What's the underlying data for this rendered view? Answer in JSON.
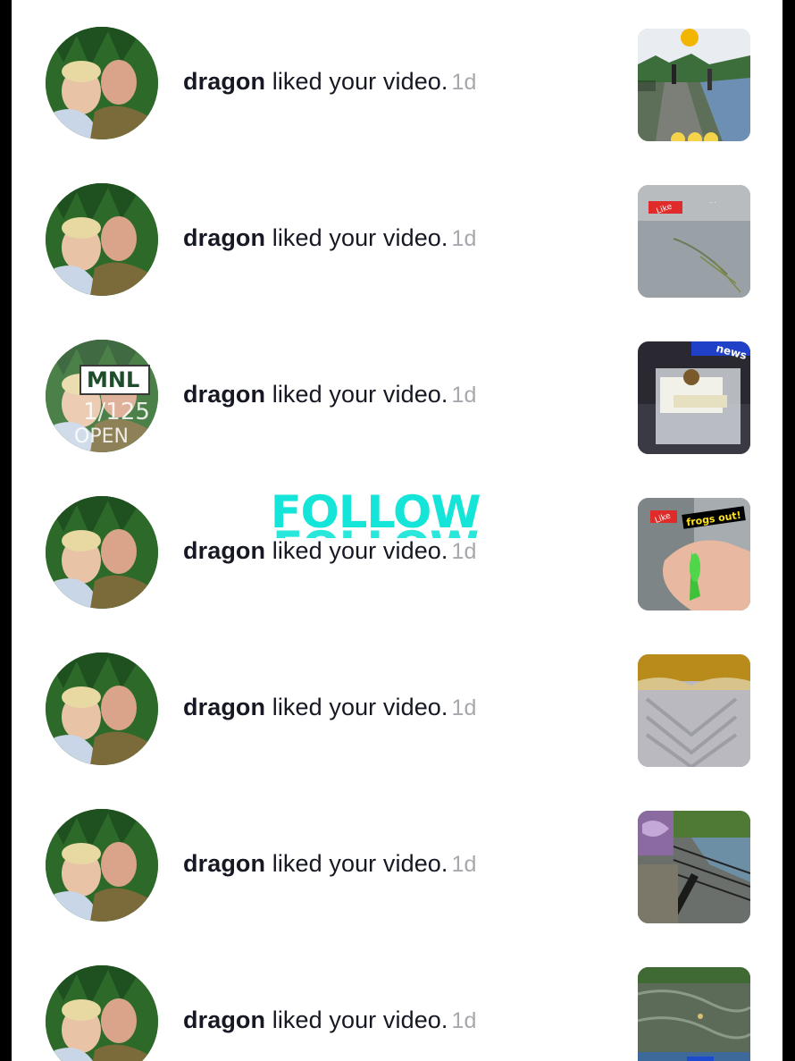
{
  "notifications": [
    {
      "user": "dragon",
      "action": "liked your video.",
      "time": "1d",
      "thumb": "towpath-walk"
    },
    {
      "user": "dragon",
      "action": "liked your video.",
      "time": "1d",
      "thumb": "grey-water"
    },
    {
      "user": "dragon",
      "action": "liked your video.",
      "time": "1d",
      "thumb": "tackle-box"
    },
    {
      "user": "dragon",
      "action": "liked your video.",
      "time": "1d",
      "thumb": "frog-lure"
    },
    {
      "user": "dragon",
      "action": "liked your video.",
      "time": "1d",
      "thumb": "blurred-abstract"
    },
    {
      "user": "dragon",
      "action": "liked your video.",
      "time": "1d",
      "thumb": "canal-graffiti"
    },
    {
      "user": "dragon",
      "action": "liked your video.",
      "time": "1d",
      "thumb": "pond-water"
    }
  ],
  "overlays": {
    "mnl": {
      "badge": "MNL",
      "count": "1/125",
      "label": "OPEN"
    },
    "follow": {
      "text": "FOLLOW",
      "color": "#14e5d8"
    }
  },
  "thumb_texts": {
    "like_sticker": "Like",
    "frogs_out": "frogs out!",
    "news_tag": "news"
  },
  "colors": {
    "background": "#ffffff",
    "text": "#161823",
    "muted": "#a7a8ad",
    "accent": "#14e5d8"
  }
}
